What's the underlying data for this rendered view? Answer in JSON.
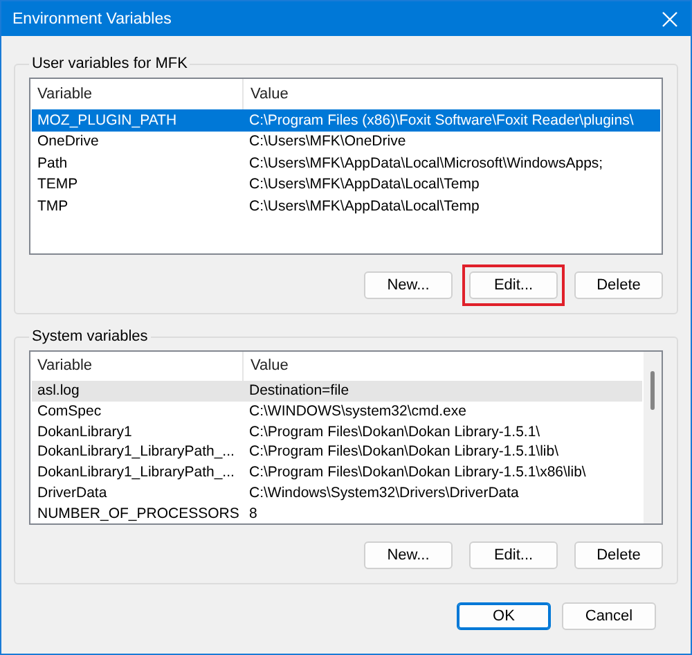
{
  "window": {
    "title": "Environment Variables"
  },
  "user_variables": {
    "title": "User variables for MFK",
    "columns": [
      "Variable",
      "Value"
    ],
    "rows": [
      {
        "variable": "MOZ_PLUGIN_PATH",
        "value": "C:\\Program Files (x86)\\Foxit Software\\Foxit Reader\\plugins\\",
        "selected": true
      },
      {
        "variable": "OneDrive",
        "value": "C:\\Users\\MFK\\OneDrive",
        "selected": false
      },
      {
        "variable": "Path",
        "value": "C:\\Users\\MFK\\AppData\\Local\\Microsoft\\WindowsApps;",
        "selected": false
      },
      {
        "variable": "TEMP",
        "value": "C:\\Users\\MFK\\AppData\\Local\\Temp",
        "selected": false
      },
      {
        "variable": "TMP",
        "value": "C:\\Users\\MFK\\AppData\\Local\\Temp",
        "selected": false
      }
    ],
    "buttons": [
      {
        "label": "New...",
        "highlighted": false
      },
      {
        "label": "Edit...",
        "highlighted": true
      },
      {
        "label": "Delete",
        "highlighted": false
      }
    ]
  },
  "system_variables": {
    "title": "System variables",
    "columns": [
      "Variable",
      "Value"
    ],
    "rows": [
      {
        "variable": "asl.log",
        "value": "Destination=file",
        "selected": false,
        "hovered": true
      },
      {
        "variable": "ComSpec",
        "value": "C:\\WINDOWS\\system32\\cmd.exe",
        "selected": false,
        "hovered": false
      },
      {
        "variable": "DokanLibrary1",
        "value": "C:\\Program Files\\Dokan\\Dokan Library-1.5.1\\",
        "selected": false,
        "hovered": false
      },
      {
        "variable": "DokanLibrary1_LibraryPath_...",
        "value": "C:\\Program Files\\Dokan\\Dokan Library-1.5.1\\lib\\",
        "selected": false,
        "hovered": false
      },
      {
        "variable": "DokanLibrary1_LibraryPath_...",
        "value": "C:\\Program Files\\Dokan\\Dokan Library-1.5.1\\x86\\lib\\",
        "selected": false,
        "hovered": false
      },
      {
        "variable": "DriverData",
        "value": "C:\\Windows\\System32\\Drivers\\DriverData",
        "selected": false,
        "hovered": false
      },
      {
        "variable": "NUMBER_OF_PROCESSORS",
        "value": "8",
        "selected": false,
        "hovered": false
      }
    ],
    "buttons": [
      {
        "label": "New...",
        "highlighted": false
      },
      {
        "label": "Edit...",
        "highlighted": false
      },
      {
        "label": "Delete",
        "highlighted": false
      }
    ]
  },
  "dialog_buttons": [
    {
      "label": "OK",
      "default": true
    },
    {
      "label": "Cancel",
      "default": false
    }
  ]
}
